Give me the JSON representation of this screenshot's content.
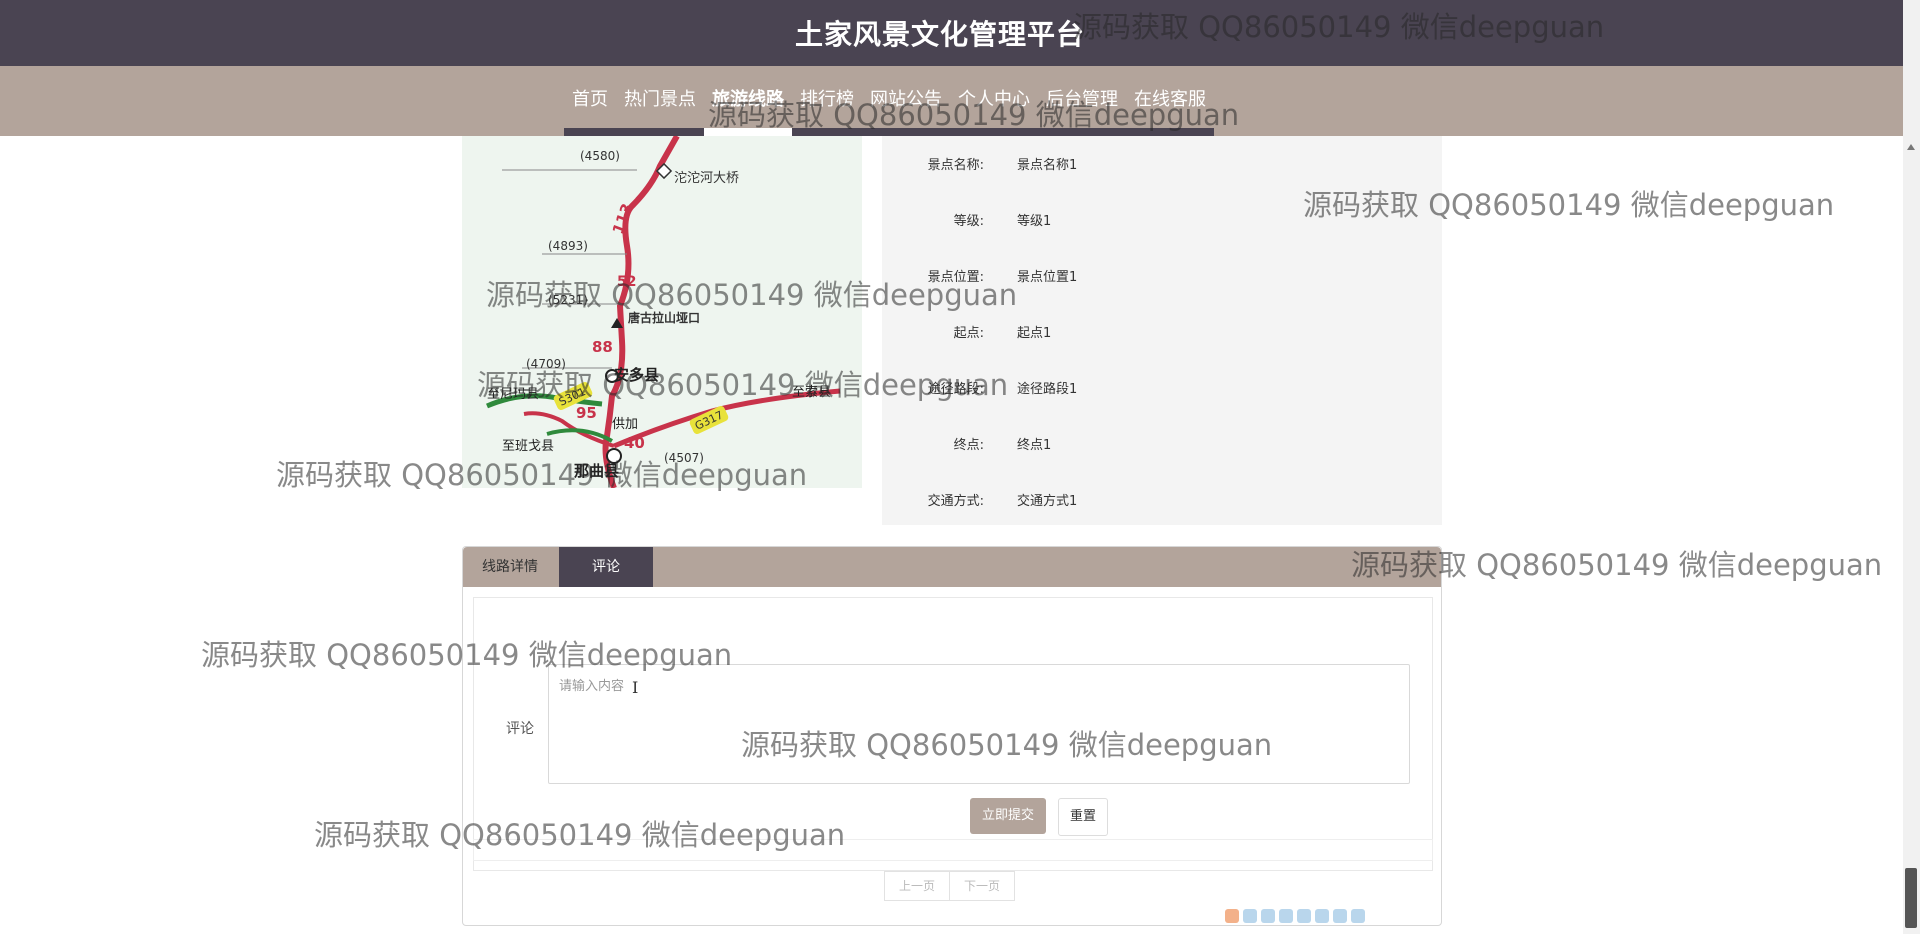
{
  "app": {
    "title": "土家风景文化管理平台"
  },
  "nav": {
    "items": [
      {
        "label": "首页",
        "active": false
      },
      {
        "label": "热门景点",
        "active": false
      },
      {
        "label": "旅游线路",
        "active": true
      },
      {
        "label": "排行榜",
        "active": false
      },
      {
        "label": "网站公告",
        "active": false
      },
      {
        "label": "个人中心",
        "active": false
      },
      {
        "label": "后台管理",
        "active": false
      },
      {
        "label": "在线客服",
        "active": false
      }
    ]
  },
  "map": {
    "labels": {
      "bridge": "沱沱河大桥",
      "pass": "唐古拉山垭口",
      "county_anduo": "安多县",
      "to_nima": "至尼玛县",
      "to_bange": "至班戈县",
      "to_suo": "至索县",
      "gongjia": "供加",
      "naqu": "那曲县",
      "alt_4580": "(4580)",
      "alt_4893": "(4893)",
      "alt_5231": "(5231)",
      "alt_4709": "(4709)",
      "alt_4507": "(4507)",
      "km_113": "113",
      "km_52": "52",
      "km_88": "88",
      "km_95": "95",
      "km_40": "40",
      "road_s301": "S301",
      "road_g317": "G317"
    }
  },
  "route_info": {
    "rows": [
      {
        "key": "景点名称:",
        "value": "景点名称1"
      },
      {
        "key": "等级:",
        "value": "等级1"
      },
      {
        "key": "景点位置:",
        "value": "景点位置1"
      },
      {
        "key": "起点:",
        "value": "起点1"
      },
      {
        "key": "途径路段:",
        "value": "途径路段1"
      },
      {
        "key": "终点:",
        "value": "终点1"
      },
      {
        "key": "交通方式:",
        "value": "交通方式1"
      }
    ]
  },
  "tabs": [
    {
      "label": "线路详情",
      "active": false
    },
    {
      "label": "评论",
      "active": true
    }
  ],
  "comment_form": {
    "label": "评论",
    "placeholder": "请输入内容",
    "submit_label": "立即提交",
    "reset_label": "重置"
  },
  "pager": {
    "prev_label": "上一页",
    "next_label": "下一页"
  },
  "watermark": {
    "text": "源码获取 QQ86050149 微信deepguan"
  },
  "colors": {
    "header_bg": "#4a4452",
    "nav_bg": "#b3a49b",
    "panel_bg": "#f4f4f4",
    "accent": "#b3a49b"
  }
}
